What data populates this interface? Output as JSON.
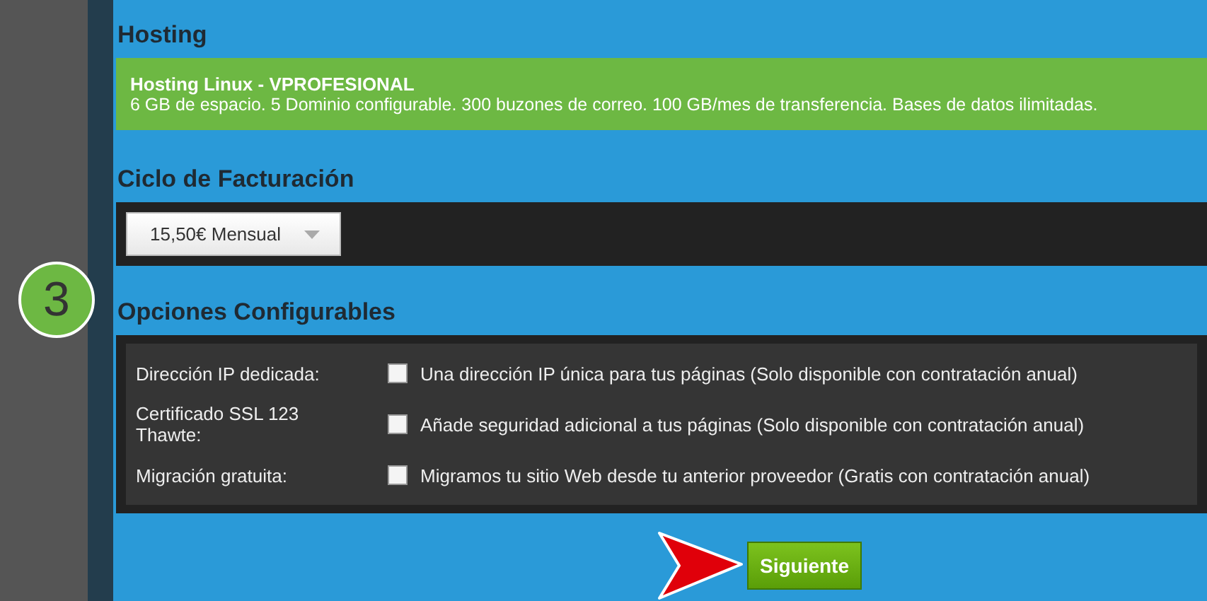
{
  "step": "3",
  "hosting": {
    "title": "Hosting",
    "plan_name": "Hosting Linux - VPROFESIONAL",
    "plan_description": "6 GB de espacio. 5 Dominio configurable. 300 buzones de correo. 100 GB/mes de transferencia. Bases de datos ilimitadas."
  },
  "billing": {
    "title": "Ciclo de Facturación",
    "value": "15,50€ Mensual"
  },
  "options": {
    "title": "Opciones Configurables",
    "rows": [
      {
        "label": "Dirección IP dedicada:",
        "description": "Una dirección IP única para tus páginas (Solo disponible con contratación anual)",
        "checked": false
      },
      {
        "label": "Certificado SSL 123 Thawte:",
        "description": "Añade seguridad adicional a tus páginas (Solo disponible con contratación anual)",
        "checked": false
      },
      {
        "label": "Migración gratuita:",
        "description": "Migramos tu sitio Web desde tu anterior proveedor (Gratis con contratación anual)",
        "checked": false
      }
    ]
  },
  "next_button": "Siguiente"
}
